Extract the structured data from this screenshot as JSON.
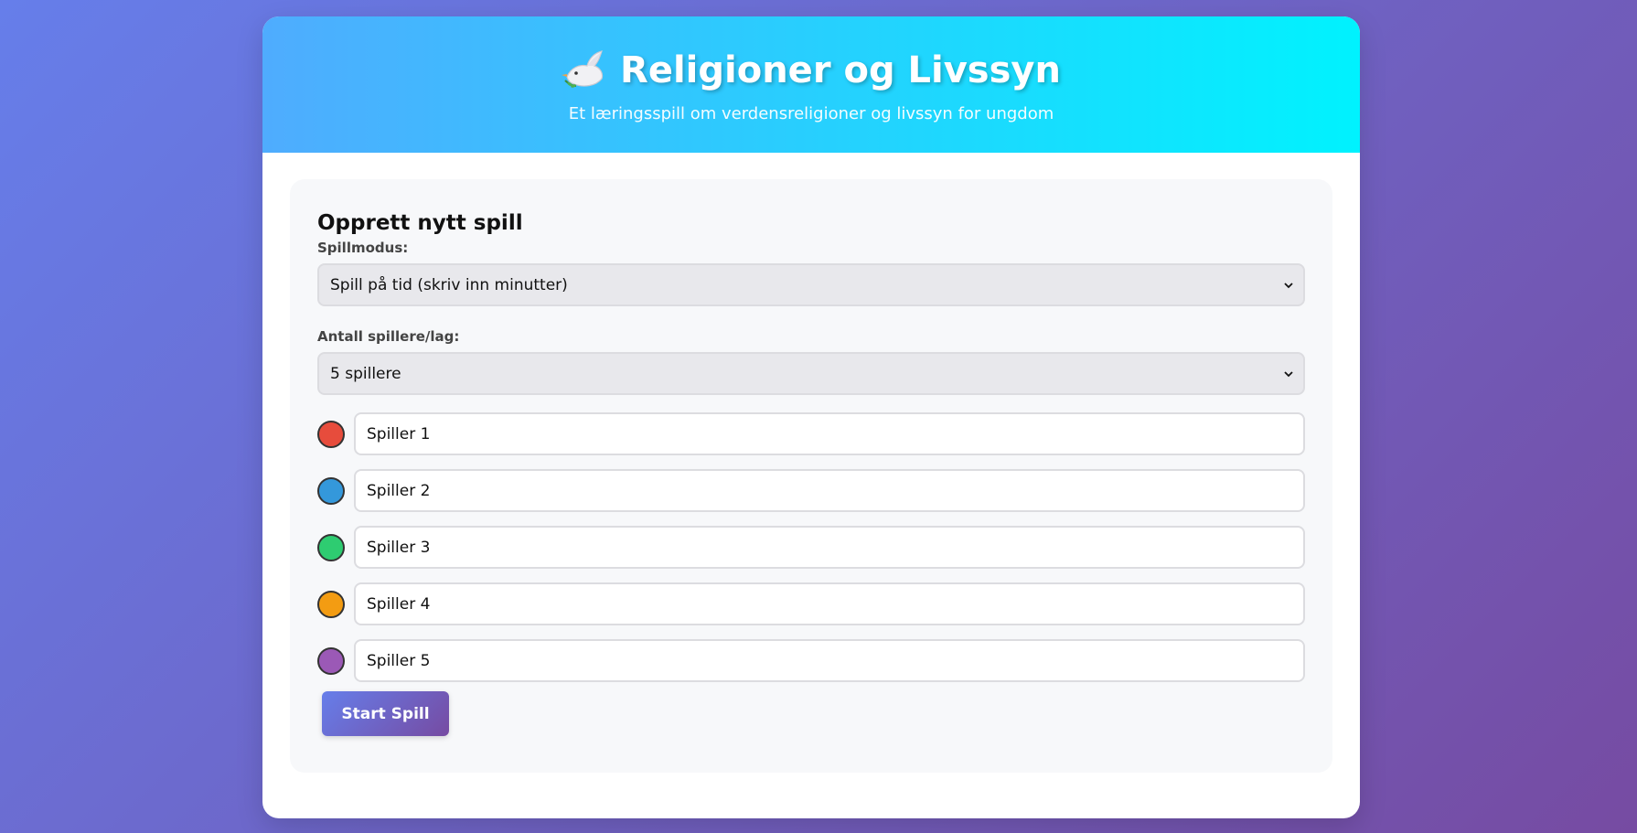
{
  "header": {
    "title": "Religioner og Livssyn",
    "icon": "dove-icon",
    "subtitle": "Et læringsspill om verdensreligioner og livssyn for ungdom"
  },
  "form": {
    "heading": "Opprett nytt spill",
    "mode_label": "Spillmodus:",
    "mode_value": "Spill på tid (skriv inn minutter)",
    "count_label": "Antall spillere/lag:",
    "count_value": "5 spillere",
    "players": [
      {
        "value": "Spiller 1",
        "color": "#e74c3c"
      },
      {
        "value": "Spiller 2",
        "color": "#3498db"
      },
      {
        "value": "Spiller 3",
        "color": "#2ecc71"
      },
      {
        "value": "Spiller 4",
        "color": "#f39c12"
      },
      {
        "value": "Spiller 5",
        "color": "#9b59b6"
      }
    ],
    "start_label": "Start Spill"
  },
  "colors": {
    "background_start": "#667eea",
    "background_end": "#764ba2",
    "header_start": "#4facfe",
    "header_end": "#00f2fe"
  }
}
